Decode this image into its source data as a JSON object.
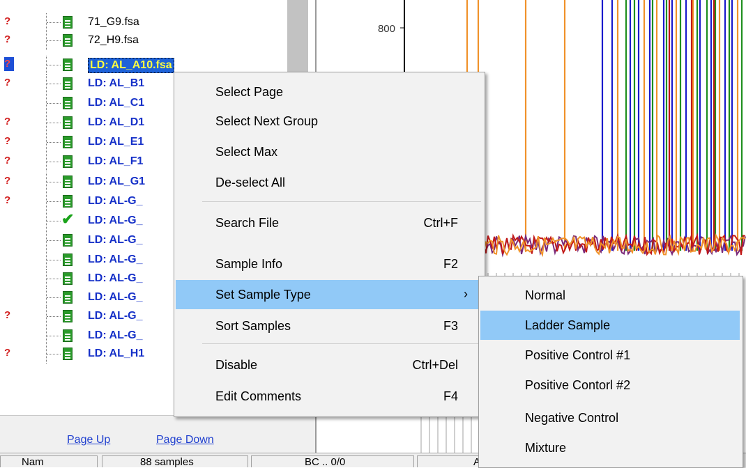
{
  "tree": {
    "rows": [
      {
        "flag": "?",
        "icon": "file",
        "name": "71_G9.fsa",
        "style": "normal"
      },
      {
        "flag": "?",
        "icon": "file",
        "name": "72_H9.fsa",
        "style": "normal"
      },
      {
        "flag": "?",
        "icon": "file",
        "name": "LD: AL_A10.fsa",
        "style": "selected"
      },
      {
        "flag": "?",
        "icon": "file",
        "name": "LD: AL_B1",
        "style": "ladder"
      },
      {
        "flag": "",
        "icon": "file",
        "name": "LD: AL_C1",
        "style": "ladder"
      },
      {
        "flag": "?",
        "icon": "file",
        "name": "LD: AL_D1",
        "style": "ladder"
      },
      {
        "flag": "?",
        "icon": "file",
        "name": "LD: AL_E1",
        "style": "ladder"
      },
      {
        "flag": "?",
        "icon": "file",
        "name": "LD: AL_F1",
        "style": "ladder"
      },
      {
        "flag": "?",
        "icon": "file",
        "name": "LD: AL_G1",
        "style": "ladder"
      },
      {
        "flag": "?",
        "icon": "file",
        "name": "LD: AL-G_",
        "style": "ladder"
      },
      {
        "flag": "",
        "icon": "check",
        "name": "LD: AL-G_",
        "style": "ladder"
      },
      {
        "flag": "",
        "icon": "file",
        "name": "LD: AL-G_",
        "style": "ladder"
      },
      {
        "flag": "",
        "icon": "file",
        "name": "LD: AL-G_",
        "style": "ladder"
      },
      {
        "flag": "",
        "icon": "file",
        "name": "LD: AL-G_",
        "style": "ladder"
      },
      {
        "flag": "",
        "icon": "file",
        "name": "LD: AL-G_",
        "style": "ladder"
      },
      {
        "flag": "?",
        "icon": "file",
        "name": "LD: AL-G_",
        "style": "ladder"
      },
      {
        "flag": "",
        "icon": "file",
        "name": "LD: AL-G_",
        "style": "ladder"
      },
      {
        "flag": "?",
        "icon": "file",
        "name": "LD: AL_H1",
        "style": "ladder"
      }
    ]
  },
  "pager": {
    "page_up": "Page Up",
    "page_down": "Page Down"
  },
  "chart": {
    "y_tick_label": "800",
    "colors": {
      "orange": "#f0922a",
      "blue": "#1a1acc",
      "green": "#1f8f1f",
      "red": "#c01818",
      "gray": "#d0d0d0"
    }
  },
  "status_bar": {
    "cells": [
      "Nam",
      "88 samples",
      "BC .. 0/0",
      "A"
    ]
  },
  "context_menu": {
    "items": [
      {
        "label": "Select Page",
        "shortcut": ""
      },
      {
        "label": "Select Next Group",
        "shortcut": ""
      },
      {
        "label": "Select Max",
        "shortcut": ""
      },
      {
        "label": "De-select All",
        "shortcut": ""
      },
      {
        "label": "Search File",
        "shortcut": "Ctrl+F"
      },
      {
        "label": "Sample Info",
        "shortcut": "F2"
      },
      {
        "label": "Set Sample Type",
        "shortcut": "",
        "submenu": true,
        "highlighted": true
      },
      {
        "label": "Sort Samples",
        "shortcut": "F3"
      },
      {
        "label": "Disable",
        "shortcut": "Ctrl+Del"
      },
      {
        "label": "Edit Comments",
        "shortcut": "F4"
      }
    ]
  },
  "submenu": {
    "items": [
      {
        "label": "Normal"
      },
      {
        "label": "Ladder Sample",
        "highlighted": true
      },
      {
        "label": "Positive Control #1"
      },
      {
        "label": "Positive Contorl #2"
      },
      {
        "label": "Negative Control"
      },
      {
        "label": "Mixture"
      }
    ]
  }
}
